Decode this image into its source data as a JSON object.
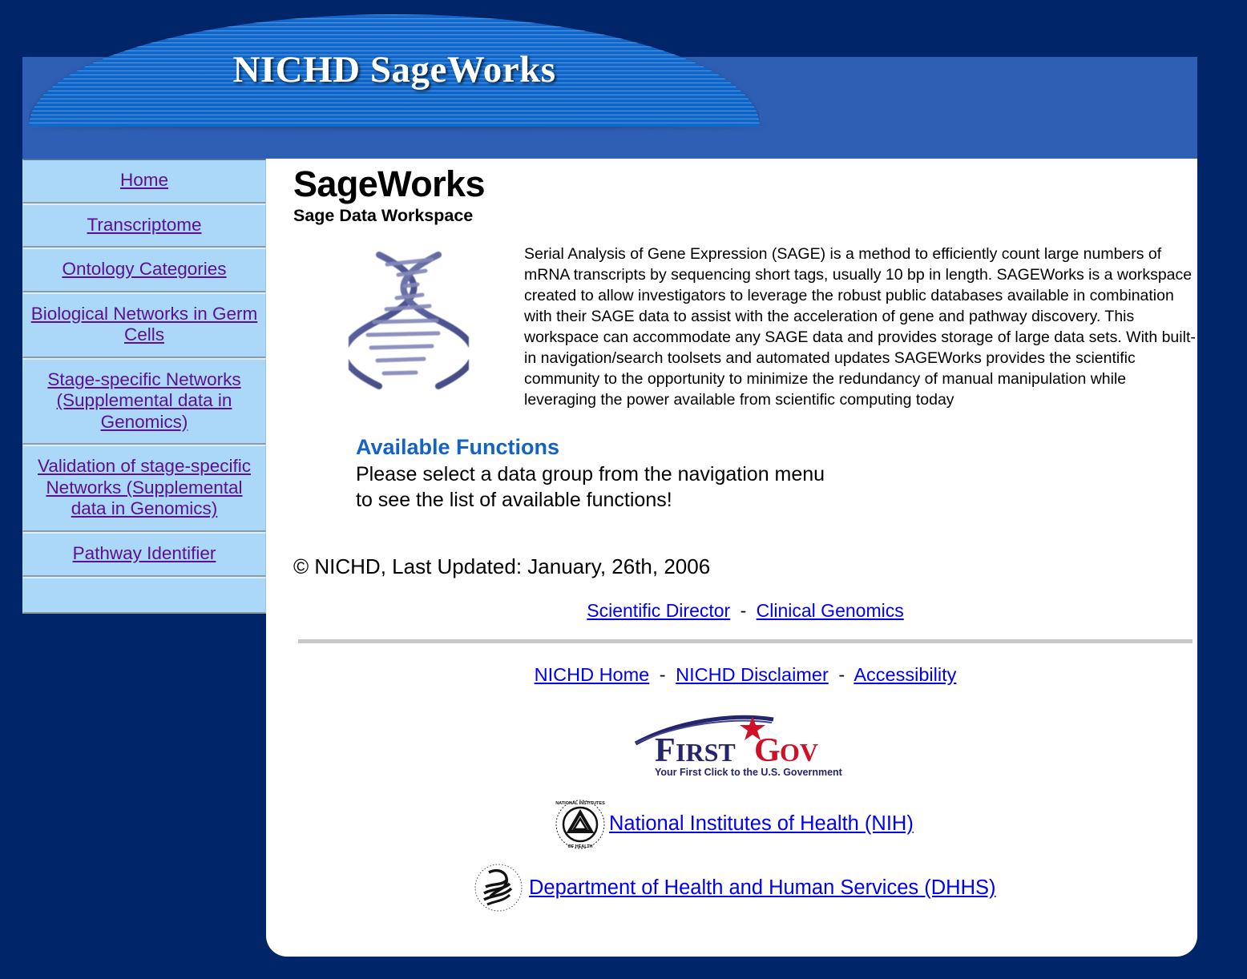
{
  "banner": {
    "title": "NICHD SageWorks"
  },
  "sidebar": {
    "items": [
      {
        "label": "Home"
      },
      {
        "label": "Transcriptome"
      },
      {
        "label": "Ontology Categories"
      },
      {
        "label": "Biological Networks in Germ Cells"
      },
      {
        "label": "Stage-specific Networks (Supplemental data in Genomics)"
      },
      {
        "label": "Validation of stage-specific Networks (Supplemental data in Genomics)"
      },
      {
        "label": "Pathway Identifier"
      }
    ]
  },
  "main": {
    "title": "SageWorks",
    "subtitle": "Sage Data Workspace",
    "intro_paragraph": "Serial Analysis of Gene Expression (SAGE) is a method to efficiently count large numbers of mRNA transcripts by sequencing short tags, usually 10 bp in length. SAGEWorks is a workspace created to allow investigators to leverage the robust public databases available in combination with their SAGE data to assist with the acceleration of gene and pathway discovery. This workspace can accommodate any SAGE data and provides storage of large data sets. With built-in navigation/search toolsets and automated updates SAGEWorks provides the scientific community to the opportunity to minimize the redundancy of manual manipulation while leveraging the power available from scientific computing today",
    "available_functions_heading": "Available Functions",
    "available_functions_line1": "Please select a data group from the navigation menu",
    "available_functions_line2": "to see the list of available functions!",
    "copyright": "© NICHD, Last Updated: January, 26th, 2006"
  },
  "footer": {
    "director_links": [
      {
        "label": "Scientific Director"
      },
      {
        "label": "Clinical Genomics"
      }
    ],
    "gov_links": [
      {
        "label": "NICHD Home"
      },
      {
        "label": "NICHD Disclaimer"
      },
      {
        "label": "Accessibility"
      }
    ],
    "separator": "-",
    "firstgov": {
      "word_first": "First",
      "word_gov": "Gov",
      "tagline": "Your First Click to the U.S. Government"
    },
    "nih_link": "National Institutes of Health (NIH)",
    "dhhs_link": "Department of Health and Human Services (DHHS)"
  },
  "colors": {
    "page_background": "#002569",
    "banner_band": "#2f5fb4",
    "dome_blue": "#1169cf",
    "sidebar_cell": "#abd7f9",
    "sidebar_link": "#5c0f92",
    "link_blue": "#0000ee",
    "heading_blue": "#1362c4",
    "divider_gray": "#c8c8c8",
    "firstgov_navy": "#24256b",
    "firstgov_red": "#cf1027"
  }
}
